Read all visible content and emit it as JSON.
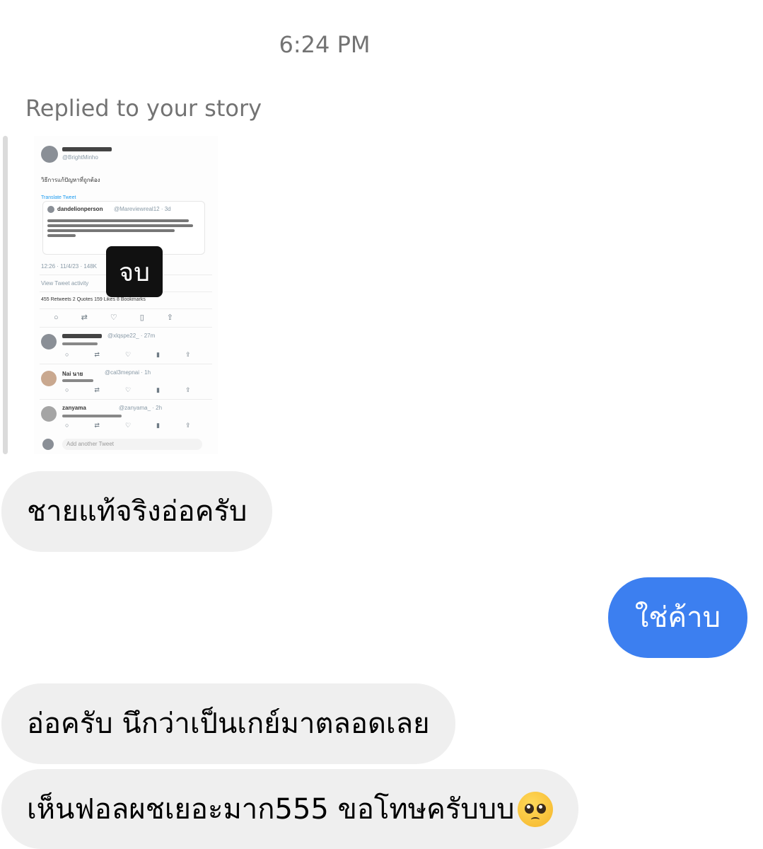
{
  "thread": {
    "timestamp": "6:24 PM",
    "reply_context": "Replied to your story",
    "story": {
      "overlay_text": "จบ",
      "tweet": {
        "author_handle": "@BrightMinho",
        "body": "วิธีการแก้ปัญหาที่ถูกต้อง",
        "translate": "Translate Tweet",
        "quote_author": "dandelionperson",
        "quote_handle": "@Mareviewreal12 · 3d",
        "meta": "12:26 · 11/4/23 · 148K",
        "activity": "View Tweet activity",
        "stats": "455 Retweets  2 Quotes  159 Likes  8 Bookmarks",
        "reply_1_handle": "@xlqspe22_ · 27m",
        "reply_2_name": "Nai นาย",
        "reply_2_handle": "@cal3mepnai · 1h",
        "reply_3_name": "zanyama",
        "reply_3_handle": "@zanyama_ · 2h",
        "add_placeholder": "Add another Tweet"
      }
    },
    "messages": [
      {
        "direction": "incoming",
        "text": "ชายแท้จริงอ่อครับ"
      },
      {
        "direction": "outgoing",
        "text": "ใช่ค้าบ"
      },
      {
        "direction": "incoming",
        "text": "อ่อครับ นึกว่าเป็นเกย์มาตลอดเลย"
      },
      {
        "direction": "incoming",
        "text": "เห็นฟอลผชเยอะมาก555 ขอโทษครับบบ",
        "emoji": "pleading-face-icon"
      }
    ],
    "colors": {
      "incoming_bubble": "#efefef",
      "outgoing_bubble": "#3c7ff0",
      "meta_text": "#737373"
    }
  }
}
